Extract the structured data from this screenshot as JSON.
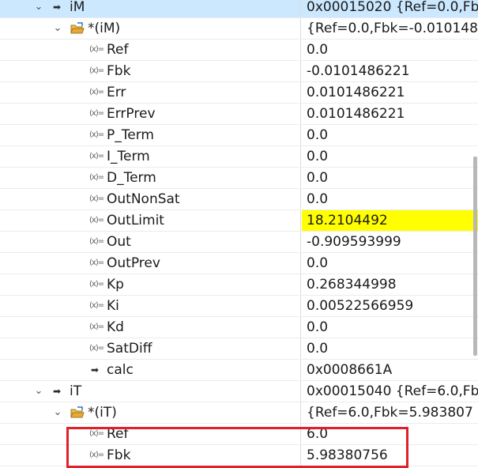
{
  "rows": [
    {
      "name": "iM",
      "value": "0x00015020 {Ref=0.0,Fb",
      "icon": "struct-arrow-icon",
      "expander": "chevron-down-icon",
      "level": 0,
      "selected": true
    },
    {
      "name": "*(iM)",
      "value": "{Ref=0.0,Fbk=-0.010148",
      "icon": "pointer-struct-icon",
      "expander": "chevron-down-icon",
      "level": 1
    },
    {
      "name": "Ref",
      "value": "0.0",
      "icon": "variable-icon",
      "level": 2
    },
    {
      "name": "Fbk",
      "value": "-0.0101486221",
      "icon": "variable-icon",
      "level": 2
    },
    {
      "name": "Err",
      "value": "0.0101486221",
      "icon": "variable-icon",
      "level": 2
    },
    {
      "name": "ErrPrev",
      "value": "0.0101486221",
      "icon": "variable-icon",
      "level": 2
    },
    {
      "name": "P_Term",
      "value": "0.0",
      "icon": "variable-icon",
      "level": 2
    },
    {
      "name": "I_Term",
      "value": "0.0",
      "icon": "variable-icon",
      "level": 2
    },
    {
      "name": "D_Term",
      "value": "0.0",
      "icon": "variable-icon",
      "level": 2
    },
    {
      "name": "OutNonSat",
      "value": "0.0",
      "icon": "variable-icon",
      "level": 2
    },
    {
      "name": "OutLimit",
      "value": "18.2104492",
      "icon": "variable-icon",
      "level": 2,
      "highlight": true
    },
    {
      "name": "Out",
      "value": "-0.909593999",
      "icon": "variable-icon",
      "level": 2
    },
    {
      "name": "OutPrev",
      "value": "0.0",
      "icon": "variable-icon",
      "level": 2
    },
    {
      "name": "Kp",
      "value": "0.268344998",
      "icon": "variable-icon",
      "level": 2
    },
    {
      "name": "Ki",
      "value": "0.00522566959",
      "icon": "variable-icon",
      "level": 2
    },
    {
      "name": "Kd",
      "value": "0.0",
      "icon": "variable-icon",
      "level": 2
    },
    {
      "name": "SatDiff",
      "value": "0.0",
      "icon": "variable-icon",
      "level": 2
    },
    {
      "name": "calc",
      "value": "0x0008661A",
      "icon": "function-arrow-icon",
      "level": 2
    },
    {
      "name": "iT",
      "value": "0x00015040 {Ref=6.0,Fbk",
      "icon": "struct-arrow-icon",
      "expander": "chevron-down-icon",
      "level": 0
    },
    {
      "name": "*(iT)",
      "value": "{Ref=6.0,Fbk=5.983807",
      "icon": "pointer-struct-icon",
      "expander": "chevron-down-icon",
      "level": 1
    },
    {
      "name": "Ref",
      "value": "6.0",
      "icon": "variable-icon",
      "level": 2
    },
    {
      "name": "Fbk",
      "value": "5.98380756",
      "icon": "variable-icon",
      "level": 2
    }
  ],
  "colors": {
    "highlight": "#ffff00",
    "selected_row": "#cce8ff",
    "annotation_box": "#e0202a"
  },
  "icons": {
    "variable": "(x)=",
    "arrow": "➡",
    "chevron": "⌄"
  }
}
